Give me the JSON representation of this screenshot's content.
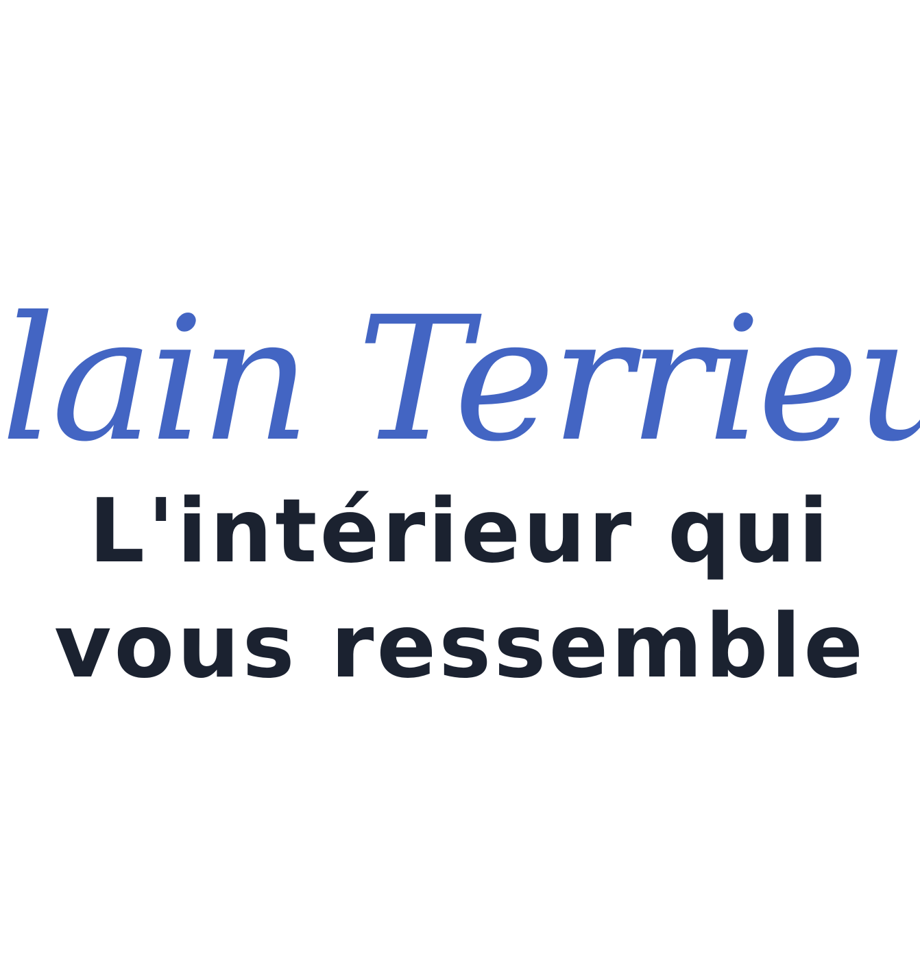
{
  "logo": {
    "brand_name": "Alain Terrieur",
    "brand_color": "#2f55bd",
    "tagline_line1": "L'intérieur qui",
    "tagline_line2": "vous ressemble",
    "tagline_color": "#1b2230",
    "background_color": "#ffffff"
  }
}
